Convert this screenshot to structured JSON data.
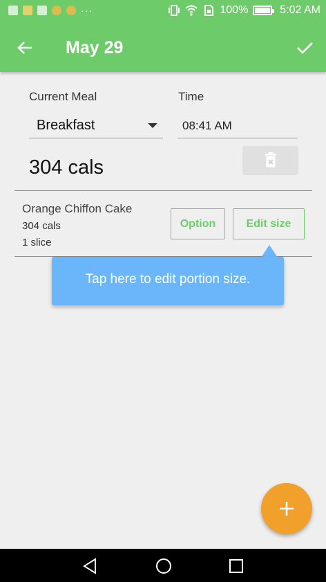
{
  "status_bar": {
    "battery_text": "100%",
    "time": "5:02 AM",
    "overflow": "···",
    "battery_level": 1.0,
    "left_icons": [
      "notification-icon",
      "photos-icon",
      "notification-icon",
      "chrome-icon",
      "chrome-icon"
    ],
    "right_icons": [
      "vibrate-icon",
      "wifi-icon",
      "sim-icon",
      "battery-icon"
    ]
  },
  "header": {
    "title": "May 29",
    "back_icon": "arrow-left-icon",
    "confirm_icon": "check-icon",
    "color": "#6dcb6a"
  },
  "meal": {
    "label": "Current Meal",
    "value": "Breakfast"
  },
  "time": {
    "label": "Time",
    "value": "08:41 AM"
  },
  "summary": {
    "calories": "304 cals",
    "delete_icon": "trash-icon"
  },
  "food_items": [
    {
      "name": "Orange Chiffon Cake",
      "calories": "304 cals",
      "portion": "1 slice",
      "option_label": "Option",
      "edit_label": "Edit size"
    }
  ],
  "tooltip": {
    "text": "Tap here to edit portion size.",
    "color": "#6bb6fb"
  },
  "fab": {
    "icon": "plus-icon",
    "color": "#f0a02b"
  },
  "nav_bar": {
    "buttons": [
      "back-triangle-icon",
      "home-circle-icon",
      "recents-square-icon"
    ]
  }
}
